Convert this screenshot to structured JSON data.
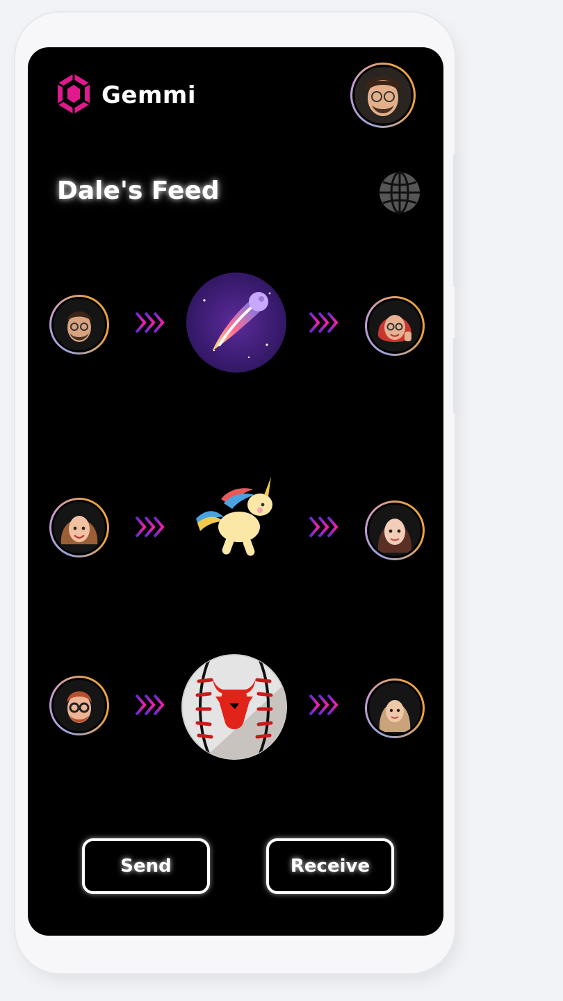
{
  "app": {
    "title": "Gemmi",
    "feed_title": "Dale's Feed"
  },
  "icons": {
    "logo": "gem-logo-icon",
    "globe": "globe-icon",
    "chevrons": "triple-chevron-right-icon"
  },
  "colors": {
    "background": "#000000",
    "accent": "#e0198e",
    "chevron_start": "#5a2bd6",
    "chevron_end": "#ff1fa8",
    "avatar_ring_start": "#9aa3d6",
    "avatar_ring_end": "#f0a13b"
  },
  "feed": [
    {
      "sender": "avatar-man-beard-glasses",
      "gift": "comet",
      "receiver": "avatar-woman-red-hair-thumbs-up"
    },
    {
      "sender": "avatar-woman-wavy-hair",
      "gift": "unicorn",
      "receiver": "avatar-woman-long-dark-hair"
    },
    {
      "sender": "avatar-man-ginger-glasses",
      "gift": "bull-baseball",
      "receiver": "avatar-woman-hijab"
    }
  ],
  "actions": {
    "send_label": "Send",
    "receive_label": "Receive"
  }
}
